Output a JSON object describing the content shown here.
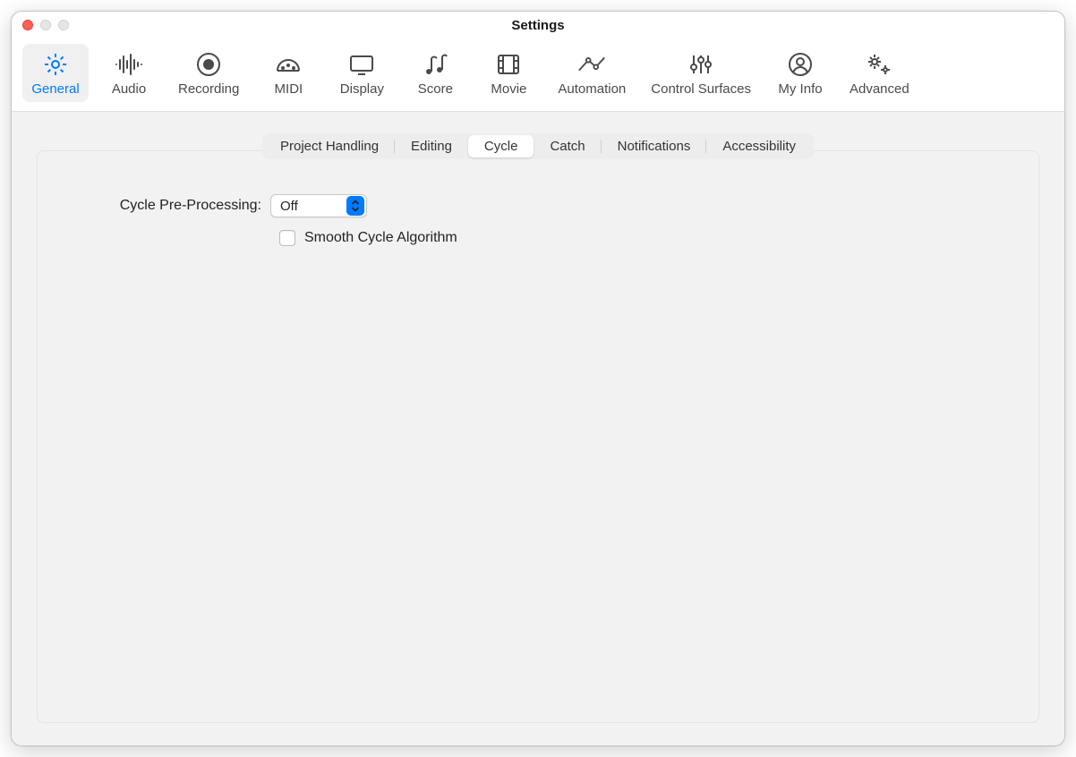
{
  "window": {
    "title": "Settings"
  },
  "toolbar": {
    "items": [
      {
        "label": "General"
      },
      {
        "label": "Audio"
      },
      {
        "label": "Recording"
      },
      {
        "label": "MIDI"
      },
      {
        "label": "Display"
      },
      {
        "label": "Score"
      },
      {
        "label": "Movie"
      },
      {
        "label": "Automation"
      },
      {
        "label": "Control Surfaces"
      },
      {
        "label": "My Info"
      },
      {
        "label": "Advanced"
      }
    ],
    "selected_index": 0
  },
  "subtabs": {
    "items": [
      {
        "label": "Project Handling"
      },
      {
        "label": "Editing"
      },
      {
        "label": "Cycle"
      },
      {
        "label": "Catch"
      },
      {
        "label": "Notifications"
      },
      {
        "label": "Accessibility"
      }
    ],
    "selected_index": 2
  },
  "cycle_section": {
    "preprocessing_label": "Cycle Pre-Processing:",
    "preprocessing_value": "Off",
    "smooth_label": "Smooth Cycle Algorithm",
    "smooth_checked": false
  },
  "colors": {
    "accent": "#007aff"
  }
}
